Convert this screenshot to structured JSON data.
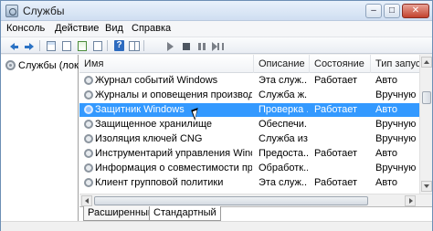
{
  "window": {
    "title": "Службы",
    "controls": {
      "minimize": "–",
      "maximize": "□",
      "close": "✕"
    }
  },
  "menu": [
    "Консоль",
    "Действие",
    "Вид",
    "Справка"
  ],
  "toolbar": [
    "back-arrow-icon",
    "forward-arrow-icon",
    "console-tree-icon",
    "properties-icon",
    "refresh-icon",
    "export-list-icon",
    "help-icon",
    "details-view-icon",
    "play-icon",
    "stop-icon",
    "pause-icon",
    "restart-icon"
  ],
  "tree": {
    "node_label": "Службы (лок"
  },
  "table": {
    "columns": [
      "Имя",
      "Описание",
      "Состояние",
      "Тип запус"
    ],
    "rows": [
      {
        "name": "Журнал событий Windows",
        "description": "Эта служ...",
        "state": "Работает",
        "startup": "Авто"
      },
      {
        "name": "Журналы и оповещения производите...",
        "description": "Служба ж...",
        "state": "",
        "startup": "Вручную"
      },
      {
        "name": "Защитник Windows",
        "description": "Проверка ...",
        "state": "Работает",
        "startup": "Авто",
        "selected": true
      },
      {
        "name": "Защищенное хранилище",
        "description": "Обеспечи...",
        "state": "",
        "startup": "Вручную"
      },
      {
        "name": "Изоляция ключей CNG",
        "description": "Служба из...",
        "state": "",
        "startup": "Вручную"
      },
      {
        "name": "Инструментарий управления Windows",
        "description": "Предоста...",
        "state": "Работает",
        "startup": "Авто"
      },
      {
        "name": "Информация о совместимости прило...",
        "description": "Обработк...",
        "state": "",
        "startup": "Вручную"
      },
      {
        "name": "Клиент групповой политики",
        "description": "Эта служ...",
        "state": "Работает",
        "startup": "Авто"
      }
    ]
  },
  "tabs": [
    "Расширенный",
    "Стандартный"
  ]
}
